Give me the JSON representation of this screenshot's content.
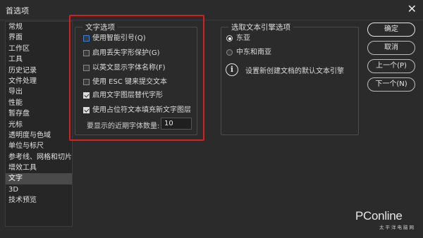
{
  "window": {
    "title": "首选项"
  },
  "sidebar": {
    "items": [
      {
        "label": "常规"
      },
      {
        "label": "界面"
      },
      {
        "label": "工作区"
      },
      {
        "label": "工具"
      },
      {
        "label": "历史记录"
      },
      {
        "label": "文件处理"
      },
      {
        "label": "导出"
      },
      {
        "label": "性能"
      },
      {
        "label": "暂存盘"
      },
      {
        "label": "光标"
      },
      {
        "label": "透明度与色域"
      },
      {
        "label": "单位与标尺"
      },
      {
        "label": "参考线、网格和切片"
      },
      {
        "label": "增效工具"
      },
      {
        "label": "文字",
        "active": true
      },
      {
        "label": "3D"
      },
      {
        "label": "技术预览"
      }
    ]
  },
  "text_options": {
    "title": "文字选项",
    "checkboxes": [
      {
        "label": "使用智能引号(Q)",
        "checked": false,
        "focused": true
      },
      {
        "label": "启用丢失字形保护(G)",
        "checked": false
      },
      {
        "label": "以英文显示字体名称(F)",
        "checked": false
      },
      {
        "label": "使用 ESC 键来提交文本",
        "checked": false
      },
      {
        "label": "启用文字图层替代字形",
        "checked": true
      },
      {
        "label": "使用占位符文本填充新文字图层",
        "checked": true
      }
    ],
    "recent_fonts_label": "要显示的近期字体数量:",
    "recent_fonts_value": "10"
  },
  "engine_options": {
    "title": "选取文本引擎选项",
    "radios": [
      {
        "label": "东亚",
        "selected": true
      },
      {
        "label": "中东和南亚",
        "selected": false
      }
    ],
    "info_text": "设置新创建文档的默认文本引擎"
  },
  "buttons": {
    "ok": "确定",
    "cancel": "取消",
    "prev": "上一个(P)",
    "next": "下一个(N)"
  },
  "watermark": {
    "logo": "PConline",
    "sub": "太平洋电脑网"
  },
  "colors": {
    "background": "#2b2b2b",
    "highlight_box": "#d62020",
    "active_sidebar": "#4a4a4a"
  }
}
